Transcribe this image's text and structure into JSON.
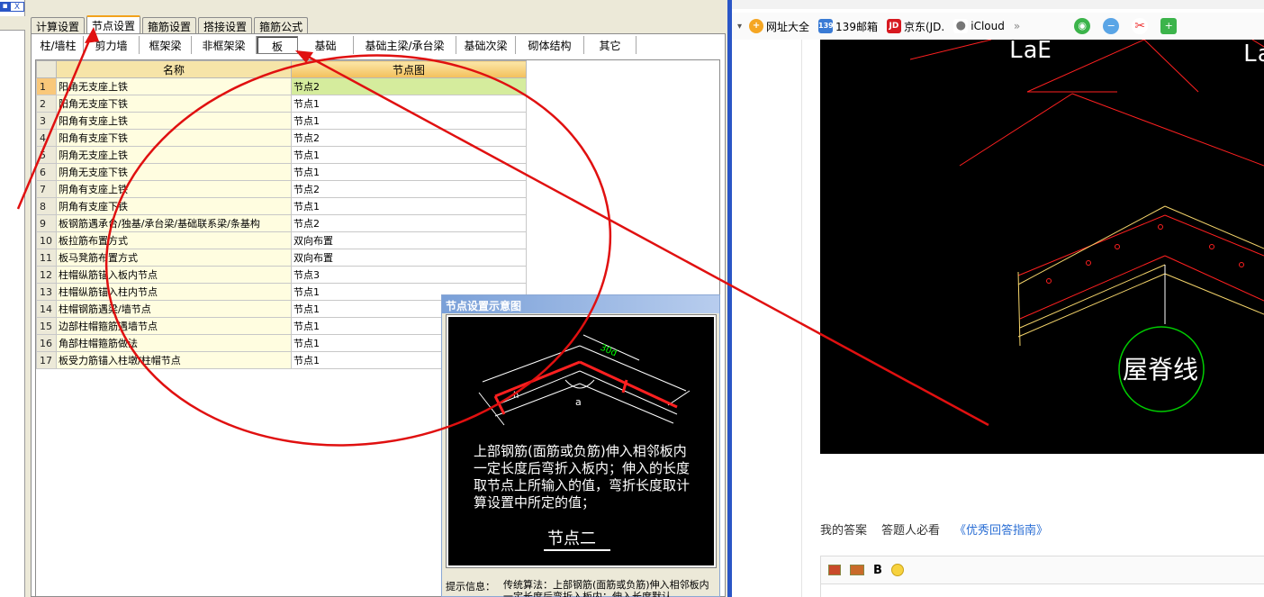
{
  "left_window": {
    "mini_buttons": [
      "▪",
      "X"
    ],
    "top_tabs": [
      "计算设置",
      "节点设置",
      "箍筋设置",
      "搭接设置",
      "箍筋公式"
    ],
    "active_top_tab": "节点设置",
    "sub_tabs": [
      "柱/墙柱",
      "剪力墙",
      "框架梁",
      "非框架梁",
      "板",
      "基础",
      "基础主梁/承台梁",
      "基础次梁",
      "砌体结构",
      "其它"
    ],
    "active_sub_tab": "板",
    "table": {
      "headers": [
        "",
        "名称",
        "节点图"
      ],
      "rows": [
        {
          "num": "1",
          "name": "阳角无支座上铁",
          "node": "节点2"
        },
        {
          "num": "2",
          "name": "阳角无支座下铁",
          "node": "节点1"
        },
        {
          "num": "3",
          "name": "阳角有支座上铁",
          "node": "节点1"
        },
        {
          "num": "4",
          "name": "阳角有支座下铁",
          "node": "节点2"
        },
        {
          "num": "5",
          "name": "阴角无支座上铁",
          "node": "节点1"
        },
        {
          "num": "6",
          "name": "阴角无支座下铁",
          "node": "节点1"
        },
        {
          "num": "7",
          "name": "阴角有支座上铁",
          "node": "节点2"
        },
        {
          "num": "8",
          "name": "阴角有支座下铁",
          "node": "节点1"
        },
        {
          "num": "9",
          "name": "板钢筋遇承台/独基/承台梁/基础联系梁/条基构",
          "node": "节点2"
        },
        {
          "num": "10",
          "name": "板拉筋布置方式",
          "node": "双向布置"
        },
        {
          "num": "11",
          "name": "板马凳筋布置方式",
          "node": "双向布置"
        },
        {
          "num": "12",
          "name": "柱帽纵筋锚入板内节点",
          "node": "节点3"
        },
        {
          "num": "13",
          "name": "柱帽纵筋锚入柱内节点",
          "node": "节点1"
        },
        {
          "num": "14",
          "name": "柱帽钢筋遇梁/墙节点",
          "node": "节点1"
        },
        {
          "num": "15",
          "name": "边部柱帽箍筋遇墙节点",
          "node": "节点1"
        },
        {
          "num": "16",
          "name": "角部柱帽箍筋做法",
          "node": "节点1"
        },
        {
          "num": "17",
          "name": "板受力筋锚入柱墩/柱帽节点",
          "node": "节点1"
        }
      ]
    },
    "diagram": {
      "title": "节点设置示意图",
      "label_h": "h",
      "label_a": "a",
      "label_dim": "30d",
      "description": "上部钢筋(面筋或负筋)伸入相邻板内一定长度后弯折入板内；伸入的长度取节点上所输入的值，弯折长度取计算设置中所定的值；",
      "caption": "节点二",
      "hint_label": "提示信息：",
      "hint_text": "传统算法：上部钢筋(面筋或负筋)伸入相邻板内一定长度后弯折入板内；伸入长度默认"
    }
  },
  "right_window": {
    "bookmarks": [
      {
        "label": "网址大全",
        "icon": "globe-icon",
        "color": "#f5a623"
      },
      {
        "label": "139邮箱",
        "icon": "mail-139-icon",
        "color": "#3a7bd5"
      },
      {
        "label": "京东(JD.",
        "icon": "jd-icon",
        "color": "#d71920"
      },
      {
        "label": "iCloud",
        "icon": "apple-icon",
        "color": "#888888"
      }
    ],
    "more_label": "»",
    "cad_labels": {
      "lae_1": "LaE",
      "lae_2": "La",
      "ridge": "屋脊线"
    },
    "answer_links": {
      "my_answer": "我的答案",
      "must_read": "答题人必看",
      "guide": "《优秀回答指南》"
    },
    "editor": {
      "bold": "B"
    }
  },
  "colors": {
    "annotation_red": "#e01010",
    "selected_row_img": "#d5ec9d",
    "header_gold": "#f3c05a",
    "divider_blue": "#2a56c6"
  }
}
